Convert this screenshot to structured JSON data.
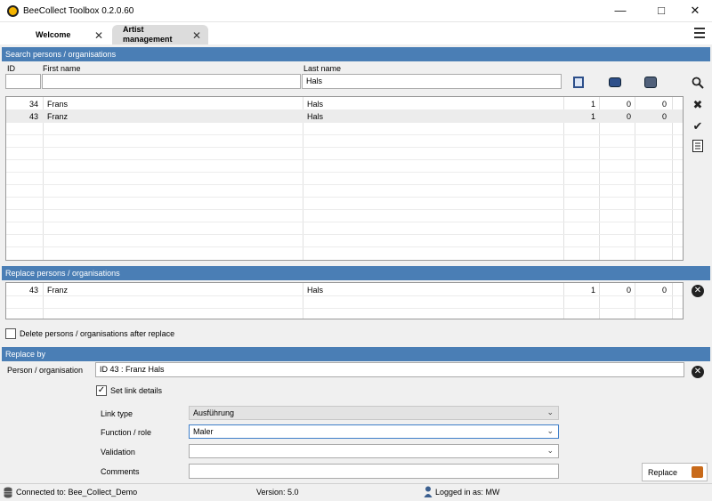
{
  "window": {
    "title": "BeeCollect Toolbox 0.2.0.60"
  },
  "tabs": [
    {
      "label": "Welcome"
    },
    {
      "label": "Artist management"
    }
  ],
  "search": {
    "header": "Search persons / organisations",
    "col_id": "ID",
    "col_first": "First name",
    "col_last": "Last name",
    "id_value": "",
    "first_value": "",
    "last_value": "Hals",
    "rows": [
      {
        "id": "34",
        "first": "Frans",
        "last": "Hals",
        "c1": "1",
        "c2": "0",
        "c3": "0"
      },
      {
        "id": "43",
        "first": "Franz",
        "last": "Hals",
        "c1": "1",
        "c2": "0",
        "c3": "0"
      }
    ]
  },
  "replace": {
    "header": "Replace persons / organisations",
    "rows": [
      {
        "id": "43",
        "first": "Franz",
        "last": "Hals",
        "c1": "1",
        "c2": "0",
        "c3": "0"
      }
    ],
    "delete_after_label": "Delete persons / organisations after replace"
  },
  "replace_by": {
    "header": "Replace by",
    "person_label": "Person / organisation",
    "person_value": "ID 43 : Franz Hals",
    "set_link_label": "Set link details",
    "link_type_label": "Link type",
    "link_type_value": "Ausführung",
    "function_label": "Function / role",
    "function_value": "Maler",
    "validation_label": "Validation",
    "validation_value": "",
    "comments_label": "Comments",
    "comments_value": "",
    "replace_button": "Replace"
  },
  "status": {
    "connected": "Connected to: Bee_Collect_Demo",
    "version": "Version: 5.0",
    "logged_in": "Logged in as: MW"
  }
}
